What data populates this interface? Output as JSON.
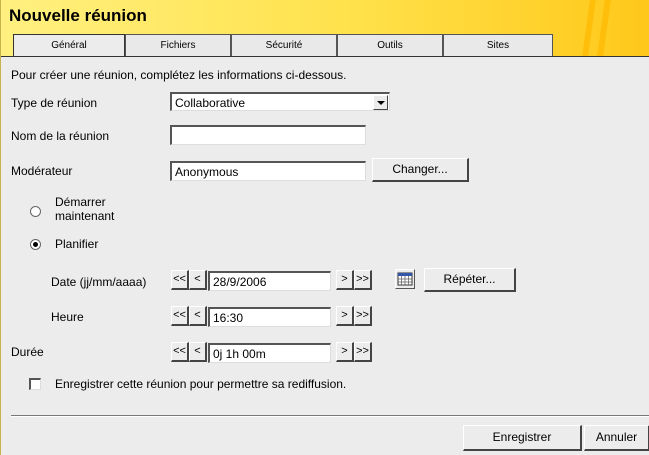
{
  "window": {
    "title": "Nouvelle réunion"
  },
  "tabs": [
    {
      "label": "Général",
      "active": true
    },
    {
      "label": "Fichiers",
      "active": false
    },
    {
      "label": "Sécurité",
      "active": false
    },
    {
      "label": "Outils",
      "active": false
    },
    {
      "label": "Sites",
      "active": false
    }
  ],
  "form": {
    "intro": "Pour créer une réunion, complétez les informations ci-dessous.",
    "meeting_type": {
      "label": "Type de réunion",
      "value": "Collaborative"
    },
    "meeting_name": {
      "label": "Nom de la réunion",
      "value": ""
    },
    "moderator": {
      "label": "Modérateur",
      "value": "Anonymous",
      "change_button": "Changer..."
    },
    "start_now": {
      "label_line1": "Démarrer",
      "label_line2": "maintenant",
      "selected": false
    },
    "schedule": {
      "label": "Planifier",
      "selected": true
    },
    "date": {
      "label": "Date (jj/mm/aaaa)",
      "value": "28/9/2006",
      "repeat_button": "Répéter..."
    },
    "time": {
      "label": "Heure",
      "value": "16:30"
    },
    "duration": {
      "label": "Durée",
      "value": "0j 1h 00m"
    },
    "stepper": {
      "prev_fast": "<<",
      "prev": "<",
      "next": ">",
      "next_fast": ">>"
    },
    "record": {
      "label": "Enregistrer cette réunion pour permettre sa rediffusion.",
      "checked": false
    }
  },
  "footer": {
    "save_button": "Enregistrer",
    "cancel_button": "Annuler"
  },
  "colors": {
    "title_bar": "#ffe14a",
    "background": "#ececec"
  },
  "icons": {
    "calendar": "calendar-icon",
    "dropdown": "chevron-down-icon"
  }
}
